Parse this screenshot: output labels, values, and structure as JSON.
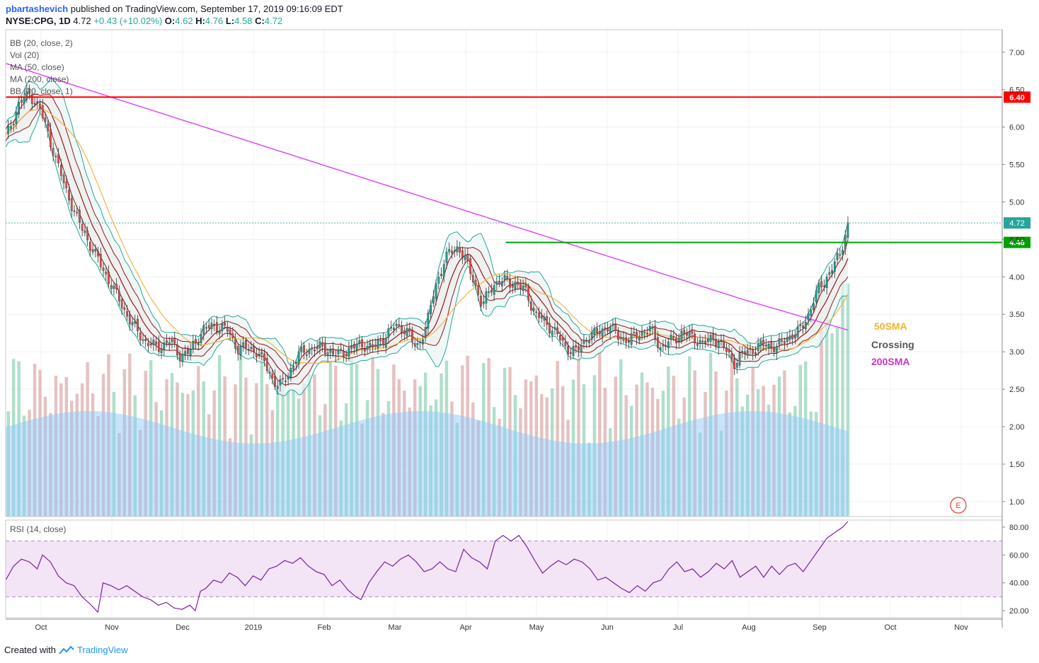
{
  "header": {
    "author": "pbartashevich",
    "published": "published on TradingView.com, September 17, 2019 09:16:09 EDT",
    "symbol": "NYSE:CPG, 1D",
    "price": "4.72",
    "change": "+0.43 (+10.02%)",
    "o_label": "O:",
    "o_value": "4.62",
    "h_label": "H:",
    "h_value": "4.76",
    "l_label": "L:",
    "l_value": "4.58",
    "c_label": "C:",
    "c_value": "4.72"
  },
  "indicators": [
    "BB (20, close, 2)",
    "Vol (20)",
    "MA (50, close)",
    "MA (200, close)",
    "BB (20, close, 1)"
  ],
  "rsi_label": "RSI (14, close)",
  "annotations": {
    "sma50": "50SMA",
    "crossing": "Crossing",
    "sma200": "200SMA",
    "earnings": "E"
  },
  "footer": {
    "created": "Created with",
    "brand": "TradingView"
  },
  "colors": {
    "up": "#26a69a",
    "down": "#ef5350",
    "bb": "#26a69a",
    "bb_mid": "#8b1a1a",
    "ma50": "#f5b342",
    "ma200": "#e040fb",
    "resistance": "#ff0000",
    "support": "#00a000",
    "rsi_line": "#7b1fa2",
    "rsi_band": "#f3e5f5",
    "sma50_text": "#f0b429",
    "crossing_text": "#555555",
    "sma200_text": "#cc33cc"
  },
  "chart_data": [
    {
      "type": "candlestick",
      "title": "NYSE:CPG, 1D",
      "x_ticks": [
        "Oct",
        "Nov",
        "Dec",
        "2019",
        "Feb",
        "Mar",
        "Apr",
        "May",
        "Jun",
        "Jul",
        "Aug",
        "Sep",
        "Oct",
        "Nov"
      ],
      "y_ticks": [
        "7.00",
        "6.50",
        "6.00",
        "5.50",
        "5.00",
        "4.50",
        "4.00",
        "3.50",
        "3.00",
        "2.50",
        "2.00",
        "1.50",
        "1.00"
      ],
      "ylim": [
        0.8,
        7.3
      ],
      "last_price": 4.72,
      "horizontal_lines": [
        {
          "price": 6.4,
          "label": "6.40",
          "color": "#ff0000"
        },
        {
          "price": 4.46,
          "label": "4.46",
          "color": "#00a000"
        }
      ],
      "close_path": [
        [
          0,
          5.85
        ],
        [
          10,
          6.3
        ],
        [
          18,
          6.45
        ],
        [
          26,
          6.25
        ],
        [
          35,
          5.75
        ],
        [
          45,
          5.2
        ],
        [
          55,
          4.75
        ],
        [
          65,
          4.4
        ],
        [
          80,
          3.9
        ],
        [
          95,
          3.4
        ],
        [
          105,
          3.15
        ],
        [
          115,
          3.05
        ],
        [
          125,
          3.15
        ],
        [
          132,
          2.95
        ],
        [
          140,
          3.0
        ],
        [
          150,
          3.3
        ],
        [
          160,
          3.35
        ],
        [
          168,
          3.3
        ],
        [
          176,
          3.05
        ],
        [
          184,
          3.05
        ],
        [
          192,
          3.0
        ],
        [
          198,
          2.8
        ],
        [
          204,
          2.6
        ],
        [
          210,
          2.55
        ],
        [
          216,
          2.75
        ],
        [
          222,
          2.95
        ],
        [
          232,
          3.05
        ],
        [
          242,
          3.05
        ],
        [
          252,
          2.95
        ],
        [
          262,
          3.05
        ],
        [
          272,
          3.1
        ],
        [
          280,
          3.05
        ],
        [
          288,
          3.2
        ],
        [
          296,
          3.35
        ],
        [
          304,
          3.3
        ],
        [
          312,
          3.05
        ],
        [
          320,
          3.35
        ],
        [
          326,
          3.85
        ],
        [
          332,
          4.15
        ],
        [
          338,
          4.35
        ],
        [
          344,
          4.4
        ],
        [
          350,
          4.2
        ],
        [
          356,
          3.95
        ],
        [
          362,
          3.6
        ],
        [
          370,
          3.9
        ],
        [
          380,
          3.95
        ],
        [
          388,
          3.9
        ],
        [
          396,
          3.8
        ],
        [
          402,
          3.5
        ],
        [
          410,
          3.4
        ],
        [
          418,
          3.25
        ],
        [
          426,
          3.05
        ],
        [
          434,
          3.0
        ],
        [
          442,
          3.2
        ],
        [
          450,
          3.25
        ],
        [
          458,
          3.35
        ],
        [
          466,
          3.2
        ],
        [
          474,
          3.15
        ],
        [
          482,
          3.25
        ],
        [
          490,
          3.3
        ],
        [
          498,
          3.05
        ],
        [
          506,
          3.15
        ],
        [
          514,
          3.25
        ],
        [
          522,
          3.2
        ],
        [
          530,
          3.1
        ],
        [
          538,
          3.2
        ],
        [
          546,
          3.05
        ],
        [
          554,
          2.85
        ],
        [
          562,
          3.0
        ],
        [
          570,
          3.05
        ],
        [
          578,
          3.1
        ],
        [
          586,
          3.05
        ],
        [
          594,
          3.2
        ],
        [
          602,
          3.25
        ],
        [
          610,
          3.5
        ],
        [
          618,
          3.85
        ],
        [
          626,
          4.05
        ],
        [
          634,
          4.3
        ],
        [
          640,
          4.72
        ]
      ],
      "volume_ylim": [
        0,
        18
      ],
      "volume_note": "volume bars drawn as histogram under price panel"
    },
    {
      "type": "line",
      "title": "RSI (14, close)",
      "y_ticks": [
        "80.00",
        "60.00",
        "40.00",
        "20.00"
      ],
      "ylim": [
        15,
        85
      ],
      "overbought": 70,
      "oversold": 30,
      "values": [
        [
          0,
          42
        ],
        [
          6,
          52
        ],
        [
          12,
          57
        ],
        [
          18,
          55
        ],
        [
          24,
          50
        ],
        [
          28,
          60
        ],
        [
          34,
          55
        ],
        [
          40,
          45
        ],
        [
          46,
          40
        ],
        [
          52,
          38
        ],
        [
          58,
          30
        ],
        [
          64,
          25
        ],
        [
          70,
          19
        ],
        [
          74,
          40
        ],
        [
          80,
          38
        ],
        [
          86,
          35
        ],
        [
          92,
          38
        ],
        [
          98,
          34
        ],
        [
          104,
          30
        ],
        [
          110,
          28
        ],
        [
          116,
          24
        ],
        [
          122,
          26
        ],
        [
          128,
          22
        ],
        [
          134,
          21
        ],
        [
          140,
          24
        ],
        [
          144,
          20
        ],
        [
          148,
          34
        ],
        [
          152,
          36
        ],
        [
          158,
          42
        ],
        [
          164,
          40
        ],
        [
          170,
          47
        ],
        [
          176,
          44
        ],
        [
          182,
          38
        ],
        [
          188,
          45
        ],
        [
          194,
          42
        ],
        [
          200,
          50
        ],
        [
          206,
          52
        ],
        [
          212,
          56
        ],
        [
          218,
          54
        ],
        [
          224,
          58
        ],
        [
          230,
          52
        ],
        [
          236,
          48
        ],
        [
          242,
          46
        ],
        [
          248,
          38
        ],
        [
          254,
          42
        ],
        [
          260,
          35
        ],
        [
          266,
          30
        ],
        [
          270,
          28
        ],
        [
          276,
          40
        ],
        [
          282,
          48
        ],
        [
          288,
          55
        ],
        [
          294,
          52
        ],
        [
          300,
          57
        ],
        [
          306,
          60
        ],
        [
          312,
          55
        ],
        [
          318,
          48
        ],
        [
          324,
          50
        ],
        [
          330,
          55
        ],
        [
          336,
          50
        ],
        [
          342,
          48
        ],
        [
          348,
          64
        ],
        [
          354,
          58
        ],
        [
          360,
          55
        ],
        [
          366,
          50
        ],
        [
          372,
          70
        ],
        [
          378,
          74
        ],
        [
          384,
          70
        ],
        [
          390,
          74
        ],
        [
          396,
          66
        ],
        [
          402,
          56
        ],
        [
          408,
          47
        ],
        [
          414,
          52
        ],
        [
          420,
          56
        ],
        [
          426,
          53
        ],
        [
          432,
          57
        ],
        [
          438,
          55
        ],
        [
          444,
          50
        ],
        [
          450,
          42
        ],
        [
          456,
          44
        ],
        [
          462,
          40
        ],
        [
          468,
          36
        ],
        [
          474,
          33
        ],
        [
          480,
          38
        ],
        [
          486,
          34
        ],
        [
          492,
          40
        ],
        [
          498,
          42
        ],
        [
          504,
          50
        ],
        [
          510,
          55
        ],
        [
          516,
          48
        ],
        [
          522,
          50
        ],
        [
          528,
          44
        ],
        [
          534,
          48
        ],
        [
          540,
          54
        ],
        [
          546,
          50
        ],
        [
          552,
          56
        ],
        [
          558,
          44
        ],
        [
          564,
          48
        ],
        [
          570,
          52
        ],
        [
          576,
          44
        ],
        [
          582,
          52
        ],
        [
          588,
          46
        ],
        [
          594,
          52
        ],
        [
          600,
          54
        ],
        [
          606,
          48
        ],
        [
          612,
          56
        ],
        [
          618,
          64
        ],
        [
          624,
          72
        ],
        [
          630,
          76
        ],
        [
          636,
          80
        ],
        [
          640,
          84
        ]
      ]
    }
  ]
}
